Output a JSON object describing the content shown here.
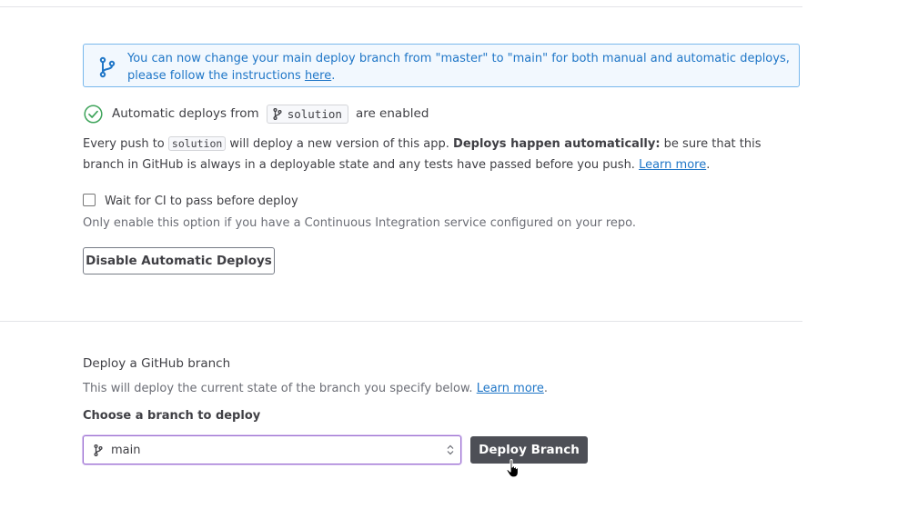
{
  "notice": {
    "text": "You can now change your main deploy branch from \"master\" to \"main\" for both manual and automatic deploys, please follow the instructions ",
    "link": "here",
    "end": "."
  },
  "auto_deploy": {
    "prefix": "Automatic deploys from",
    "branch": "solution",
    "suffix": "are enabled",
    "desc_1": "Every push to ",
    "desc_branch": "solution",
    "desc_2": " will deploy a new version of this app. ",
    "desc_bold": "Deploys happen automatically:",
    "desc_3": " be sure that this branch in GitHub is always in a deployable state and any tests have passed before you push. ",
    "desc_link": "Learn more",
    "desc_end": ".",
    "ci_label": "Wait for CI to pass before deploy",
    "ci_hint": "Only enable this option if you have a Continuous Integration service configured on your repo.",
    "disable_button": "Disable Automatic Deploys"
  },
  "manual_deploy": {
    "title": "Deploy a GitHub branch",
    "desc": "This will deploy the current state of the branch you specify below. ",
    "desc_link": "Learn more",
    "desc_end": ".",
    "choose_label": "Choose a branch to deploy",
    "selected_branch": "main",
    "deploy_button": "Deploy Branch"
  },
  "colors": {
    "link": "#1f76c7",
    "notice_border": "#79b8ec",
    "success": "#3fa45b",
    "dark_button": "#4d4f56",
    "focus": "#9b6fd1"
  }
}
